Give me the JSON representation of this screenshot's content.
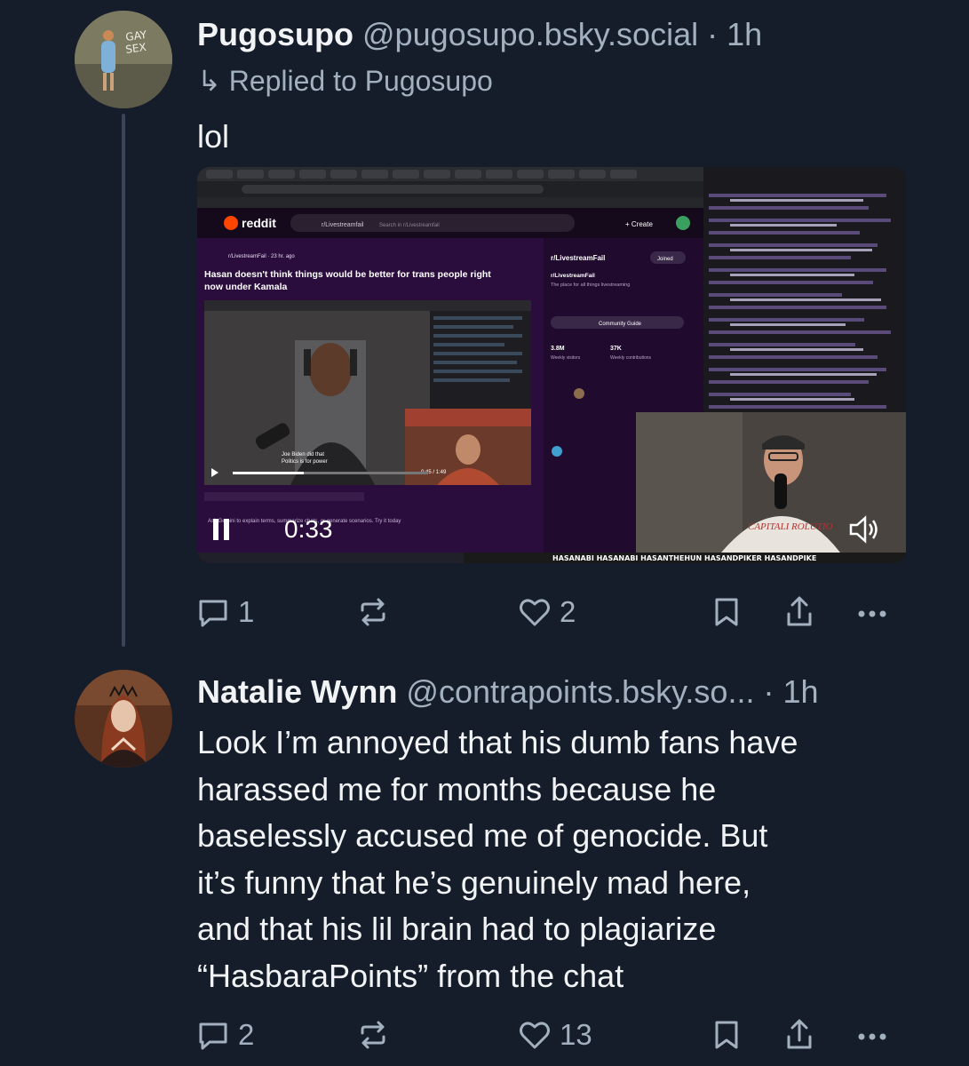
{
  "posts": [
    {
      "display_name": "Pugosupo",
      "handle": "@pugosupo.bsky.social",
      "separator": "·",
      "time": "1h",
      "reply_prefix": "↳",
      "replied_to": "Replied to Pugosupo",
      "avatar_text": "GAY SEX",
      "text": "lol",
      "video": {
        "timestamp": "0:33",
        "reddit": {
          "brand": "reddit",
          "subreddit": "r/LivestreamFail",
          "search_placeholder": "Search in r/Livestreamfail",
          "create_label": "+ Create",
          "post_title": "Hasan doesn't think things would be better for trans people right now under Kamala",
          "sidebar_title": "r/LivestreamFail",
          "sidebar_subtitle": "The place for all things livestreaming",
          "joined_label": "Joined",
          "community_guide": "Community Guide",
          "members": "3.8M",
          "members_label": "Weekly visitors",
          "contributions": "37K",
          "contributions_label": "Weekly contributions",
          "video_time": "0:45 / 1:49"
        },
        "ticker": [
          "HASANABI",
          "HASANABI",
          "HASANTHEHUN",
          "HASANDPIKER",
          "HASANDPIKE"
        ],
        "streamer_shirt": "CAPITALI ROLUTIO"
      },
      "actions": {
        "replies": "1",
        "likes": "2"
      }
    },
    {
      "display_name": "Natalie Wynn",
      "handle": "@contrapoints.bsky.so...",
      "separator": "·",
      "time": "1h",
      "text": "Look I’m annoyed that his dumb fans have\nharassed me for months because he\nbaselessly accused me of genocide. But\nit’s funny that he’s genuinely mad here,\nand that his lil brain had to plagiarize\n“HasbaraPoints” from the chat",
      "actions": {
        "replies": "2",
        "likes": "13"
      }
    }
  ],
  "colors": {
    "background": "#151d2a",
    "text": "#f1f3f5",
    "muted": "#a3b0c0",
    "thread_line": "#3a4657",
    "reddit_orange": "#ff4500",
    "reddit_purple": "#2b0d3d"
  },
  "icons": [
    "reply-icon",
    "repost-icon",
    "like-icon",
    "bookmark-icon",
    "share-icon",
    "more-icon",
    "pause-icon",
    "volume-icon"
  ]
}
